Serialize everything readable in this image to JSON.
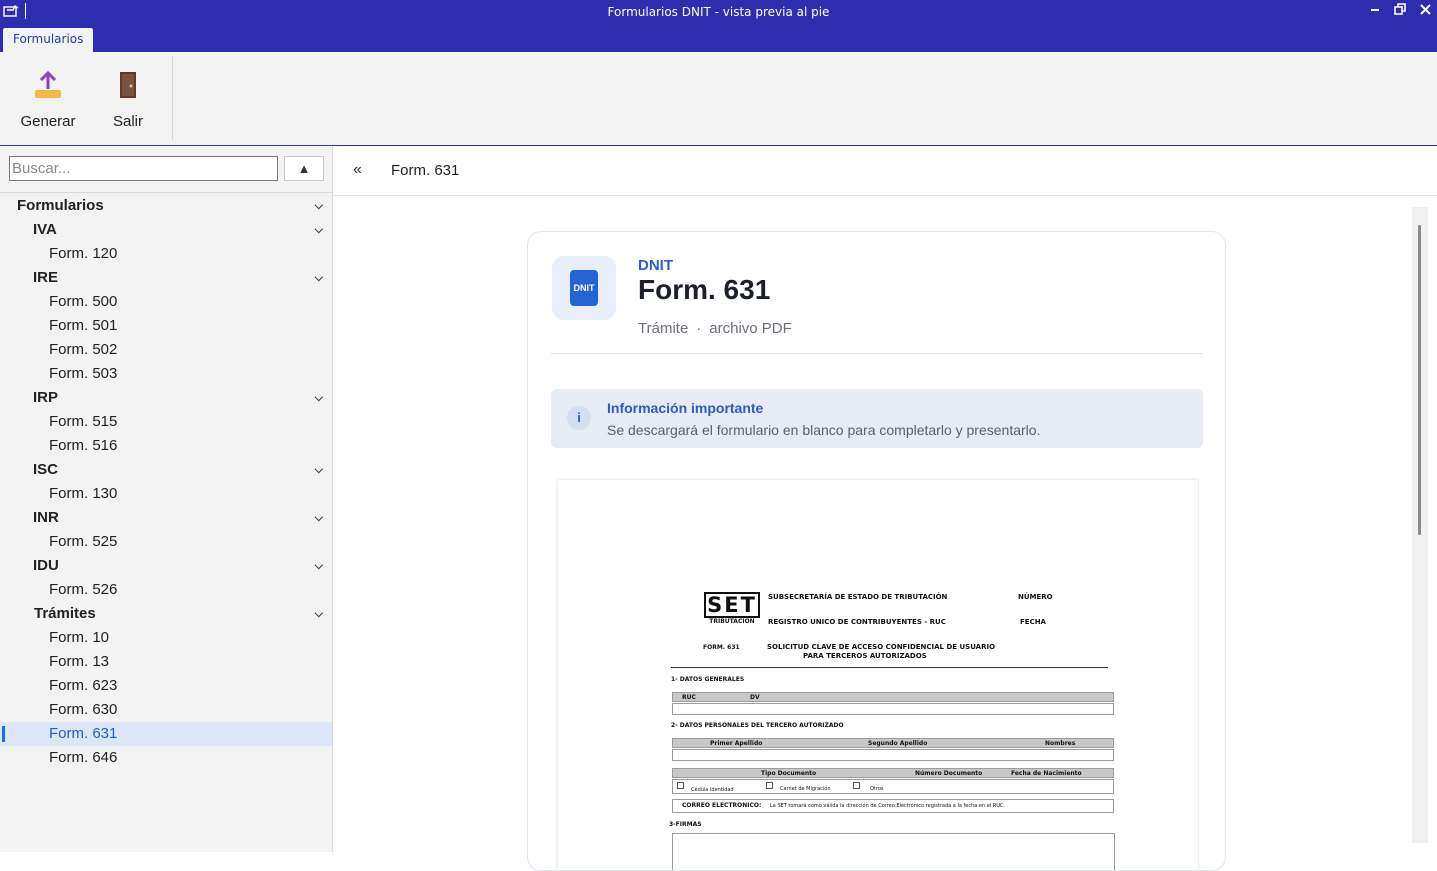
{
  "window": {
    "title": "Formularios DNIT - vista previa al pie",
    "minimize_label": "🗕",
    "restore_label": "🗗",
    "close_label": "✕"
  },
  "ribbon": {
    "tab_label": "Formularios",
    "generate_label": "Generar",
    "exit_label": "Salir"
  },
  "sidebar": {
    "search_placeholder": "Buscar...",
    "collapse_label": "▲",
    "root_label": "Formularios",
    "groups": [
      {
        "label": "IVA",
        "items": [
          "Form. 120"
        ]
      },
      {
        "label": "IRE",
        "items": [
          "Form. 500",
          "Form. 501",
          "Form. 502",
          "Form. 503"
        ]
      },
      {
        "label": "IRP",
        "items": [
          "Form. 515",
          "Form. 516"
        ]
      },
      {
        "label": "ISC",
        "items": [
          "Form. 130"
        ]
      },
      {
        "label": "INR",
        "items": [
          "Form. 525"
        ]
      },
      {
        "label": "IDU",
        "items": [
          "Form. 526"
        ]
      },
      {
        "label": "Trámites",
        "items": [
          "Form. 10",
          "Form. 13",
          "Form. 623",
          "Form. 630",
          "Form. 631",
          "Form. 646"
        ]
      }
    ],
    "selected": "Form. 631",
    "chevron": "⌄"
  },
  "main": {
    "back_label": "«",
    "breadcrumb": "Form. 631",
    "card": {
      "logo_text": "DNIT",
      "org": "DNIT",
      "title": "Form. 631",
      "meta_type": "Trámite",
      "meta_sep": "·",
      "meta_file": "archivo PDF",
      "info_icon": "i",
      "info_title": "Información importante",
      "info_text": "Se descargará el formulario en blanco para completarlo y presentarlo."
    },
    "doc": {
      "logo": "SET",
      "logo_sub": "TRIBUTACION",
      "h1": "SUBSECRETARÍA DE ESTADO DE TRIBUTACIÓN",
      "h2": "REGISTRO UNICO DE CONTRIBUYENTES - RUC",
      "numero": "NÚMERO",
      "fecha": "FECHA",
      "form_code": "FORM. 631",
      "form_title_1": "SOLICITUD CLAVE DE ACCESO CONFIDENCIAL DE USUARIO",
      "form_title_2": "PARA TERCEROS AUTORIZADOS",
      "sec1": "1- DATOS GENERALES",
      "ruc": "RUC",
      "dv": "DV",
      "sec2": "2- DATOS PERSONALES DEL TERCERO AUTORIZADO",
      "apellido1": "Primer Apellido",
      "apellido2": "Segundo Apellido",
      "nombres": "Nombres",
      "tipo_doc": "Tipo Documento",
      "num_doc": "Número Documento",
      "fecha_nac": "Fecha de Nacimiento",
      "opt1": "Cédula Identidad",
      "opt2": "Carnet de Migración",
      "opt3": "Otros",
      "correo_label": "CORREO ELECTRONICO:",
      "correo_text": "La SET tomará como válida la dirección de Correo Electrónico registrada a la fecha en el RUC.",
      "sec3": "3-FIRMAS"
    }
  }
}
